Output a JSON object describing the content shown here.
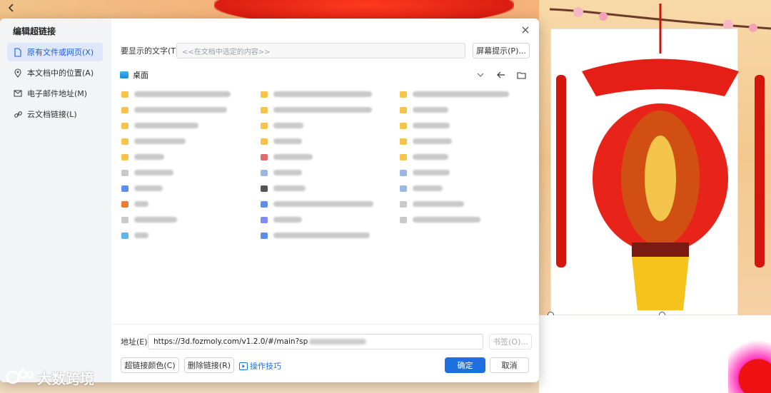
{
  "dialog": {
    "title": "编辑超链接",
    "nav": [
      {
        "label": "原有文件或网页(X)",
        "icon": "file-icon",
        "active": true
      },
      {
        "label": "本文档中的位置(A)",
        "icon": "location-pin-icon",
        "active": false
      },
      {
        "label": "电子邮件地址(M)",
        "icon": "mail-icon",
        "active": false
      },
      {
        "label": "云文档链接(L)",
        "icon": "link-icon",
        "active": false
      }
    ],
    "display_text": {
      "label": "要显示的文字(T)",
      "placeholder": "<<在文档中选定的内容>>",
      "screen_tip_button": "屏幕提示(P)..."
    },
    "location": {
      "current_folder": "桌面"
    },
    "address": {
      "label": "地址(E)",
      "value": "https://3d.fozmoly.com/v1.2.0/#/main?sp",
      "bookmark_button": "书签(O)..."
    },
    "buttons": {
      "link_color": "超链接颜色(C)",
      "remove_link": "删除链接(R)",
      "tips": "操作技巧",
      "ok": "确定",
      "cancel": "取消"
    }
  },
  "watermark": {
    "text": "大数跨境"
  },
  "colors": {
    "accent": "#1e6fe0",
    "sidebar_active_bg": "#dfe8fb",
    "folder_yellow": "#f6c34b"
  }
}
